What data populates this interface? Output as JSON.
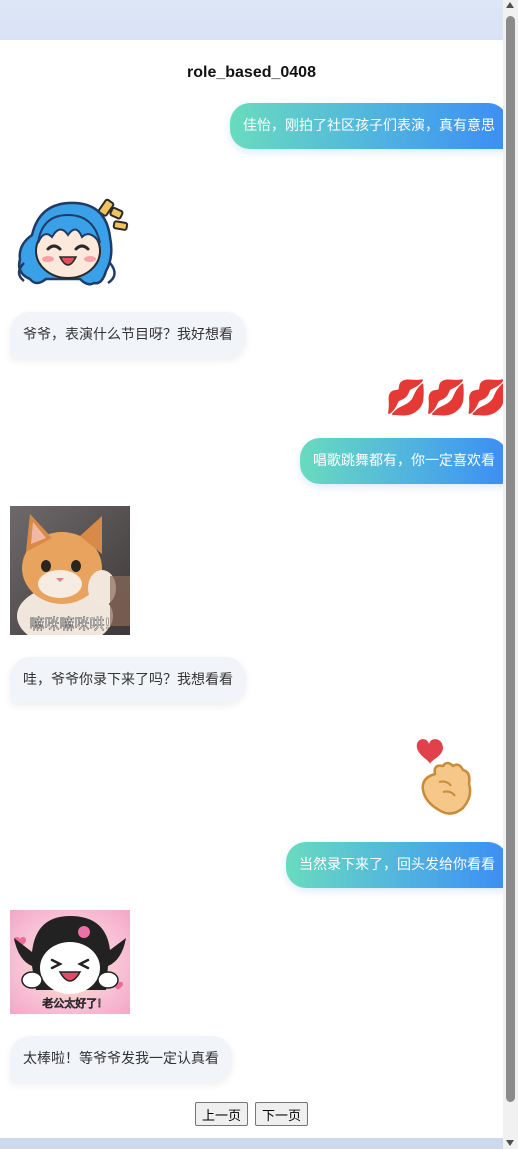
{
  "chat": {
    "title": "role_based_0408",
    "messages": [
      {
        "from": "me",
        "text": "佳怡，刚拍了社区孩子们表演，真有意思"
      },
      {
        "from": "other",
        "sticker": "chibi-blue-hair-girl-laughing"
      },
      {
        "from": "other",
        "text": "爷爷，表演什么节目呀？我好想看"
      },
      {
        "from": "me",
        "emoji": "💋💋💋"
      },
      {
        "from": "me",
        "text": "唱歌跳舞都有，你一定喜欢看"
      },
      {
        "from": "other",
        "sticker": "orange-kitten-waving",
        "caption": "嘛咪嘛咪哄!"
      },
      {
        "from": "other",
        "text": "哇，爷爷你录下来了吗？我想看看"
      },
      {
        "from": "me",
        "emoji": "🫰"
      },
      {
        "from": "me",
        "text": "当然录下来了，回头发给你看看"
      },
      {
        "from": "other",
        "sticker": "kuromi-cheering",
        "caption": "老公太好了!"
      },
      {
        "from": "other",
        "text": "太棒啦！等爷爷发我一定认真看"
      }
    ]
  },
  "pager": {
    "prev_label": "上一页",
    "next_label": "下一页"
  },
  "colors": {
    "bubble_gradient_start": "#69dbbf",
    "bubble_gradient_end": "#3c8df5",
    "incoming_bubble": "#f1f4f9"
  }
}
